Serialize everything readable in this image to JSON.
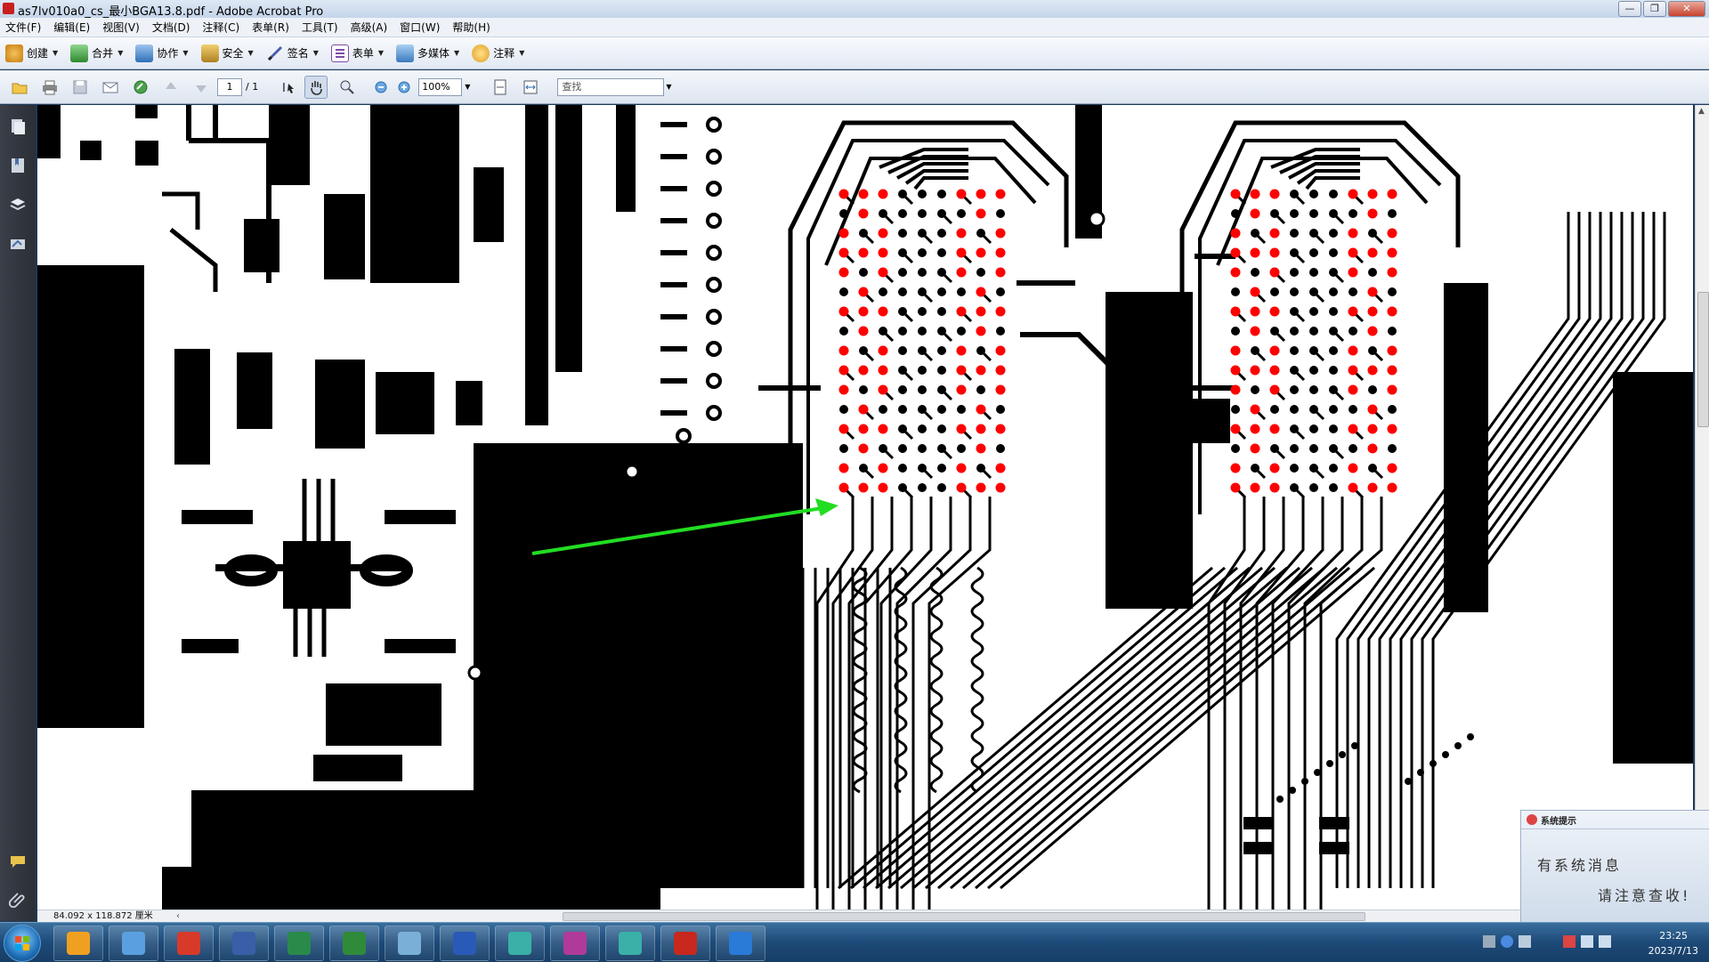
{
  "window": {
    "title": "as7lv010a0_cs_最小BGA13.8.pdf - Adobe Acrobat Pro",
    "controls": [
      "—",
      "❐",
      "✕"
    ]
  },
  "menu": [
    "文件(F)",
    "编辑(E)",
    "视图(V)",
    "文档(D)",
    "注释(C)",
    "表单(R)",
    "工具(T)",
    "高级(A)",
    "窗口(W)",
    "帮助(H)"
  ],
  "tasks": [
    {
      "label": "创建",
      "icon": "create-pdf-icon",
      "color": "#d79a2a"
    },
    {
      "label": "合并",
      "icon": "combine-files-icon",
      "color": "#3a8a3a"
    },
    {
      "label": "协作",
      "icon": "collaborate-icon",
      "color": "#2f6fb8"
    },
    {
      "label": "安全",
      "icon": "security-lock-icon",
      "color": "#c7a03a"
    },
    {
      "label": "签名",
      "icon": "sign-pen-icon",
      "color": "#4a5fa8"
    },
    {
      "label": "表单",
      "icon": "form-icon",
      "color": "#7d4aa8"
    },
    {
      "label": "多媒体",
      "icon": "multimedia-icon",
      "color": "#3a7ac0"
    },
    {
      "label": "注释",
      "icon": "comment-icon",
      "color": "#e0a020"
    }
  ],
  "nav": {
    "page_current": "1",
    "page_total": "/ 1",
    "zoom": "100%",
    "search_placeholder": "查找"
  },
  "status": {
    "page_size": "84.092 x 118.872 厘米",
    "scroll_left": "‹"
  },
  "notification": {
    "header": "系统提示",
    "line1": "有系统消息",
    "line2": "请注意查收!"
  },
  "clock": {
    "time": "23:25",
    "date": "2023/7/13"
  },
  "taskbar_apps": [
    {
      "icon": "explorer-shell-icon",
      "color": "#f0a020"
    },
    {
      "icon": "notepad-icon",
      "color": "#5aa0e0"
    },
    {
      "icon": "browser-icon",
      "color": "#d83a2a"
    },
    {
      "icon": "save-disk-icon",
      "color": "#3a5fa8"
    },
    {
      "icon": "pads-layout-icon",
      "color": "#2a8a4a"
    },
    {
      "icon": "excel-icon",
      "color": "#2f8a3a"
    },
    {
      "icon": "notebook-icon",
      "color": "#7ab0d8"
    },
    {
      "icon": "word-icon",
      "color": "#2a5ab8"
    },
    {
      "icon": "eye-viewer-icon",
      "color": "#3ab0a8"
    },
    {
      "icon": "cross-app-icon",
      "color": "#b03a9a"
    },
    {
      "icon": "eye-viewer-2-icon",
      "color": "#3ab0a8"
    },
    {
      "icon": "acrobat-icon",
      "color": "#c8281e"
    },
    {
      "icon": "cursor-app-icon",
      "color": "#2a7ad8"
    }
  ],
  "colors": {
    "copper": "#000000",
    "pad_highlight": "#ff0000",
    "arrow": "#22dd22"
  }
}
